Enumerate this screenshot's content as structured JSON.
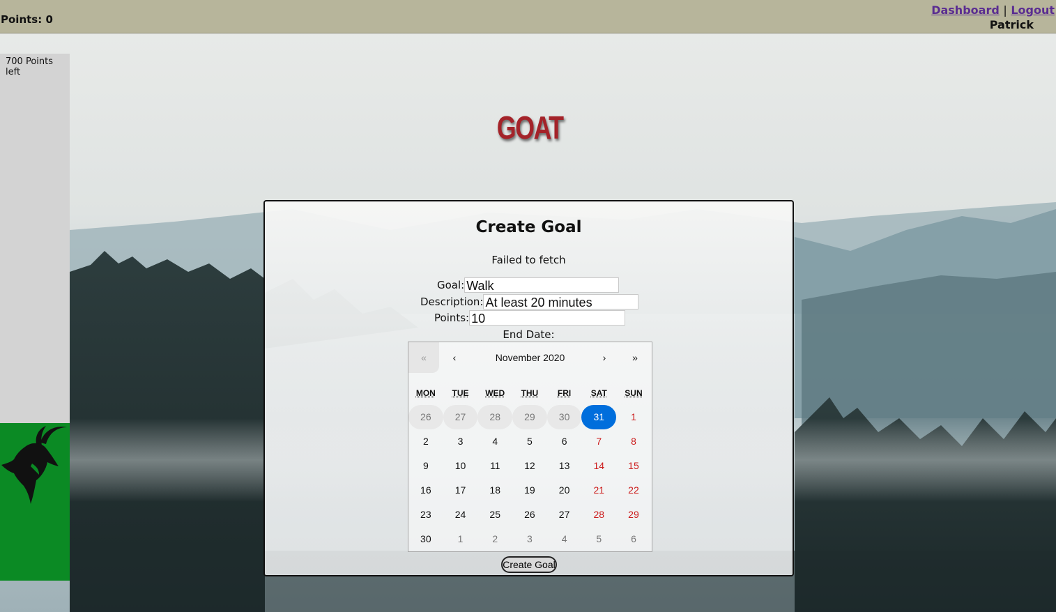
{
  "header": {
    "points_total": "Points: 0",
    "nav": {
      "dashboard": "Dashboard",
      "separator": "|",
      "logout": "Logout"
    },
    "username": "Patrick"
  },
  "sidebar": {
    "points_left": "700 Points left",
    "goat_icon": "goat-head-icon"
  },
  "logo": "GOAT",
  "form": {
    "title": "Create Goal",
    "error": "Failed to fetch",
    "goal_label": "Goal:",
    "goal_value": "Walk",
    "description_label": "Description:",
    "description_value": "At least 20 minutes",
    "points_label": "Points:",
    "points_value": "10",
    "end_date_label": "End Date:",
    "submit_label": "Create Goal"
  },
  "calendar": {
    "nav": {
      "prev_year": "«",
      "prev_month": "‹",
      "next_month": "›",
      "next_year": "»"
    },
    "month_label": "November 2020",
    "weekdays": [
      "MON",
      "TUE",
      "WED",
      "THU",
      "FRI",
      "SAT",
      "SUN"
    ],
    "weeks": [
      [
        "26",
        "27",
        "28",
        "29",
        "30",
        "31",
        "1"
      ],
      [
        "2",
        "3",
        "4",
        "5",
        "6",
        "7",
        "8"
      ],
      [
        "9",
        "10",
        "11",
        "12",
        "13",
        "14",
        "15"
      ],
      [
        "16",
        "17",
        "18",
        "19",
        "20",
        "21",
        "22"
      ],
      [
        "23",
        "24",
        "25",
        "26",
        "27",
        "28",
        "29"
      ],
      [
        "30",
        "1",
        "2",
        "3",
        "4",
        "5",
        "6"
      ]
    ],
    "selected": "31",
    "colors": {
      "selected": "#006edc",
      "weekend": "#cc1b1b",
      "sidebar_green": "#0b8a24",
      "topbar": "#b7b59b",
      "logo": "#a42329"
    }
  }
}
